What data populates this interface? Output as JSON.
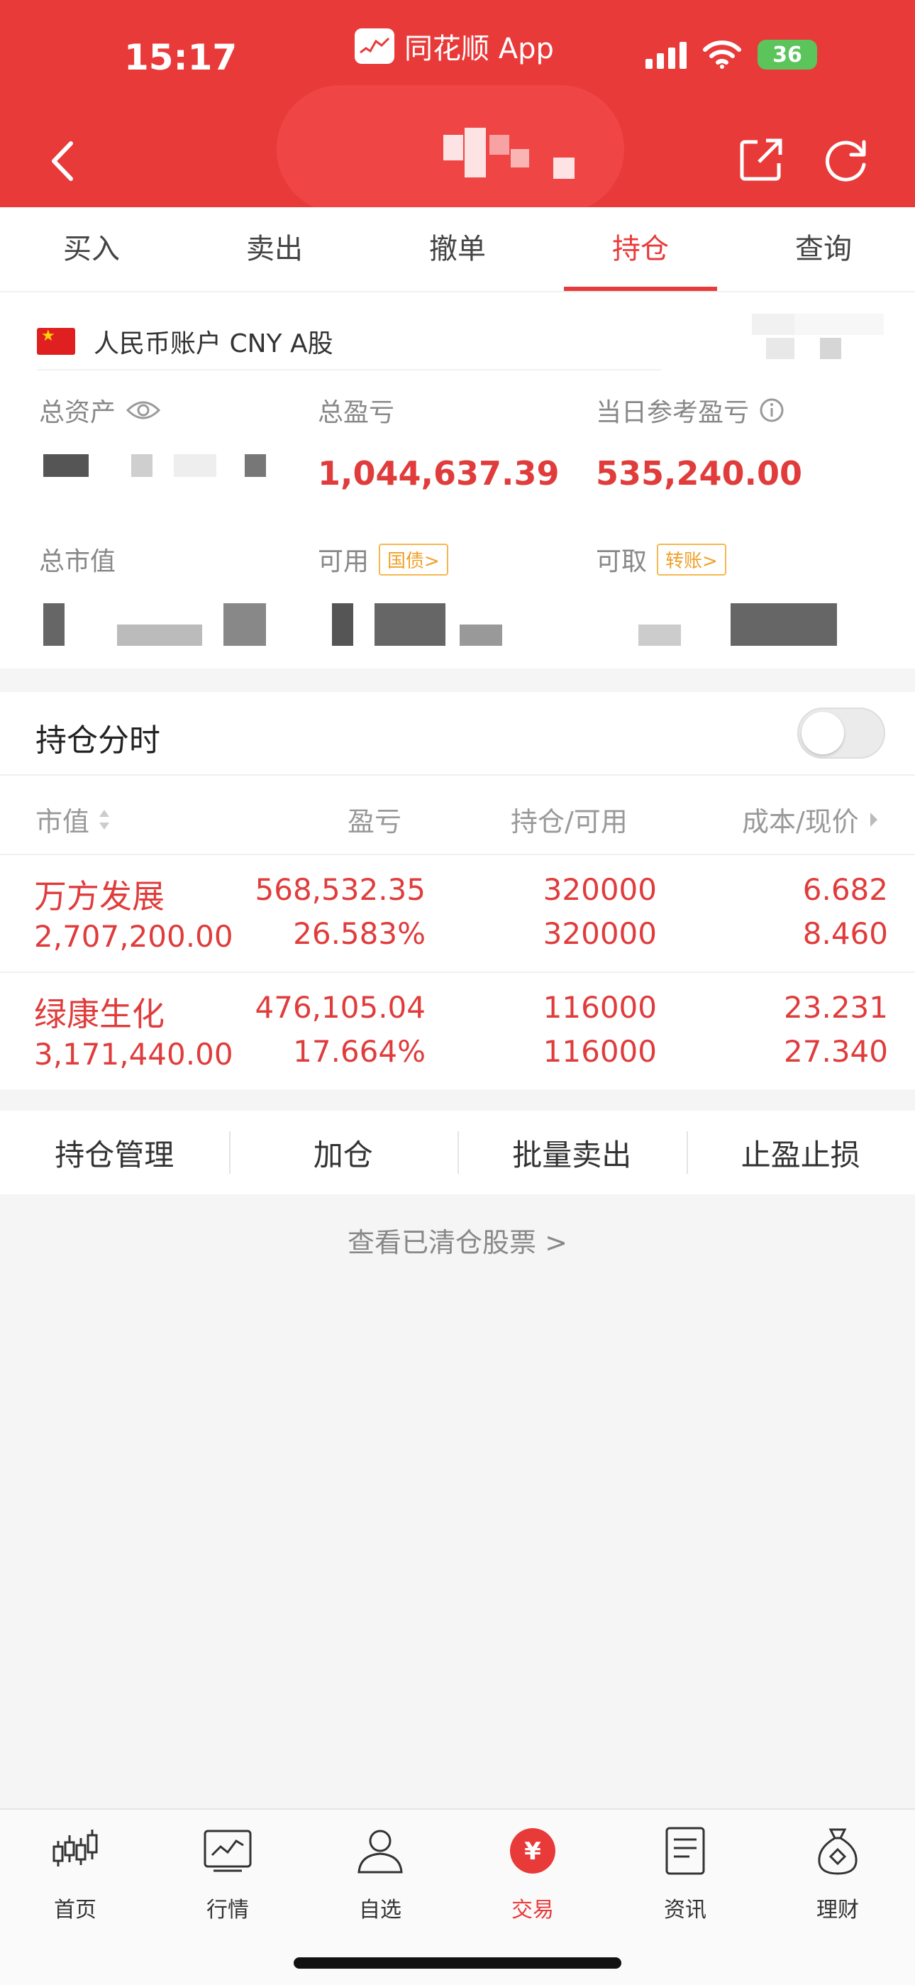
{
  "status_bar": {
    "time": "15:17",
    "app_name": "同花顺 App",
    "battery": "36"
  },
  "colors": {
    "brand_red": "#e93a3a",
    "profit_red": "#e03c3c",
    "tag_orange": "#f0a028"
  },
  "tabs": [
    {
      "label": "买入"
    },
    {
      "label": "卖出"
    },
    {
      "label": "撤单"
    },
    {
      "label": "持仓",
      "active": true
    },
    {
      "label": "查询"
    }
  ],
  "account": {
    "name": "人民币账户 CNY A股",
    "total_assets_label": "总资产",
    "total_pnl_label": "总盈亏",
    "total_pnl_value": "1,044,637.39",
    "today_pnl_label": "当日参考盈亏",
    "today_pnl_value": "535,240.00",
    "market_value_label": "总市值",
    "available_label": "可用",
    "available_tag": "国债>",
    "withdrawable_label": "可取",
    "withdrawable_tag": "转账>"
  },
  "holdings": {
    "title": "持仓分时",
    "columns": {
      "market_value": "市值",
      "pnl": "盈亏",
      "position": "持仓/可用",
      "cost": "成本/现价"
    },
    "rows": [
      {
        "name": "万方发展",
        "market_value": "2,707,200.00",
        "pnl": "568,532.35",
        "pnl_pct": "26.583%",
        "position": "320000",
        "available": "320000",
        "cost": "6.682",
        "price": "8.460"
      },
      {
        "name": "绿康生化",
        "market_value": "3,171,440.00",
        "pnl": "476,105.04",
        "pnl_pct": "17.664%",
        "position": "116000",
        "available": "116000",
        "cost": "23.231",
        "price": "27.340"
      }
    ]
  },
  "actions": [
    "持仓管理",
    "加仓",
    "批量卖出",
    "止盈止损"
  ],
  "cleared_link": "查看已清仓股票 >",
  "bottom_nav": [
    {
      "label": "首页",
      "icon": "candlestick-icon"
    },
    {
      "label": "行情",
      "icon": "chart-icon"
    },
    {
      "label": "自选",
      "icon": "user-icon"
    },
    {
      "label": "交易",
      "icon": "yuan-icon",
      "active": true
    },
    {
      "label": "资讯",
      "icon": "news-icon"
    },
    {
      "label": "理财",
      "icon": "moneybag-icon"
    }
  ]
}
